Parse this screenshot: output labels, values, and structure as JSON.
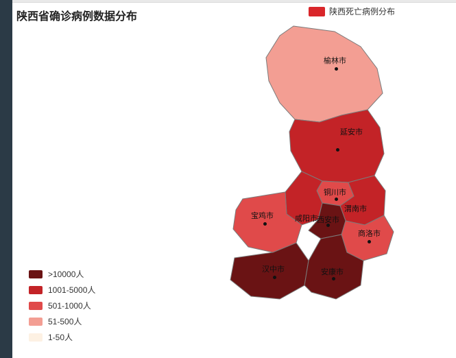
{
  "title": "陕西省确诊病例数据分布",
  "legendTop": {
    "color": "#d9262a",
    "label": "陕西死亡病例分布"
  },
  "legendLeft": [
    {
      "color": "#6a1314",
      "label": ">10000人"
    },
    {
      "color": "#c32327",
      "label": "1001-5000人"
    },
    {
      "color": "#e04a4a",
      "label": "501-1000人"
    },
    {
      "color": "#f39e93",
      "label": "51-500人"
    },
    {
      "color": "#fdf1e3",
      "label": "1-50人"
    }
  ],
  "chart_data": {
    "type": "map",
    "title": "陕西省确诊病例数据分布",
    "series_name": "陕西死亡病例分布",
    "scale": [
      {
        "range": ">10000人",
        "color": "#6a1314"
      },
      {
        "range": "1001-5000人",
        "color": "#c32327"
      },
      {
        "range": "501-1000人",
        "color": "#e04a4a"
      },
      {
        "range": "51-500人",
        "color": "#f39e93"
      },
      {
        "range": "1-50人",
        "color": "#fdf1e3"
      }
    ],
    "regions": [
      {
        "name": "榆林市",
        "bucket": "51-500人",
        "color": "#f39e93"
      },
      {
        "name": "延安市",
        "bucket": "1001-5000人",
        "color": "#c32327"
      },
      {
        "name": "铜川市",
        "bucket": "501-1000人",
        "color": "#e04a4a"
      },
      {
        "name": "渭南市",
        "bucket": "1001-5000人",
        "color": "#c32327"
      },
      {
        "name": "咸阳市",
        "bucket": "1001-5000人",
        "color": "#c32327"
      },
      {
        "name": "西安市",
        "bucket": ">10000人",
        "color": "#6a1314"
      },
      {
        "name": "宝鸡市",
        "bucket": "501-1000人",
        "color": "#e04a4a"
      },
      {
        "name": "商洛市",
        "bucket": "501-1000人",
        "color": "#e04a4a"
      },
      {
        "name": "汉中市",
        "bucket": ">10000人",
        "color": "#6a1314"
      },
      {
        "name": "安康市",
        "bucket": ">10000人",
        "color": "#6a1314"
      }
    ]
  },
  "labels": {
    "yulin": "榆林市",
    "yanan": "延安市",
    "tongchuan": "铜川市",
    "weinan": "渭南市",
    "xianyang": "咸阳市",
    "xian": "西安市",
    "baoji": "宝鸡市",
    "shangluo": "商洛市",
    "hanzhong": "汉中市",
    "ankang": "安康市"
  }
}
